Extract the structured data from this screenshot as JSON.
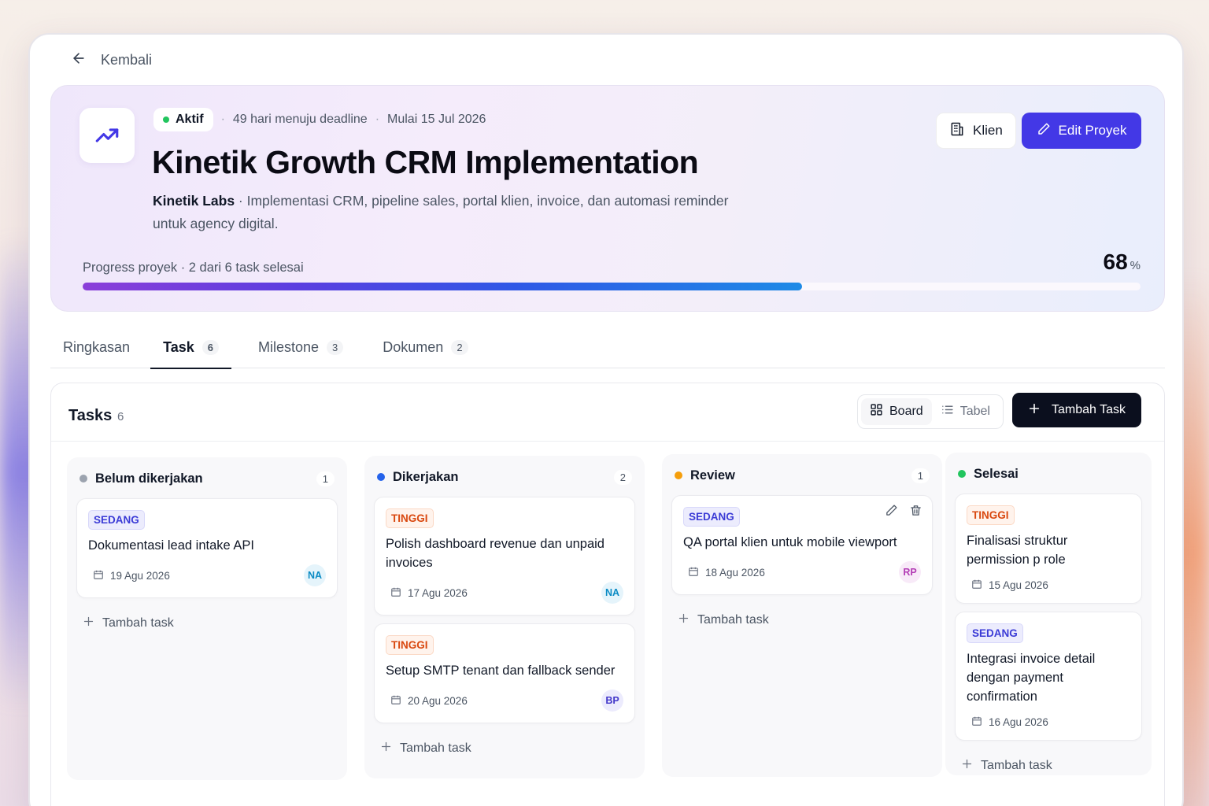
{
  "nav": {
    "back_label": "Kembali"
  },
  "project": {
    "status": "Aktif",
    "status_color": "#22c55e",
    "deadline_text": "49 hari menuju deadline",
    "start_text": "Mulai 15 Jul 2026",
    "title": "Kinetik Growth CRM Implementation",
    "client": "Kinetik Labs",
    "description": " · Implementasi CRM, pipeline sales, portal klien, invoice, dan automasi reminder untuk agency digital.",
    "client_button": "Klien",
    "edit_button": "Edit Proyek",
    "progress_label": "Progress proyek · 2 dari 6 task selesai",
    "progress_value": "68",
    "progress_unit": "%",
    "progress_fraction": 0.68
  },
  "tabs": [
    {
      "label": "Ringkasan",
      "count": ""
    },
    {
      "label": "Task",
      "count": "6"
    },
    {
      "label": "Milestone",
      "count": "3"
    },
    {
      "label": "Dokumen",
      "count": "2"
    }
  ],
  "tasks": {
    "title": "Tasks",
    "count": "6",
    "view_board": "Board",
    "view_table": "Tabel",
    "add_button": "Tambah Task",
    "add_inline": "Tambah task",
    "columns": [
      {
        "title": "Belum dikerjakan",
        "count": "1",
        "color": "#9ca3af",
        "cards": [
          {
            "priority": "SEDANG",
            "title": "Dokumentasi lead intake API",
            "date": "19 Agu 2026",
            "assignee": "NA"
          }
        ]
      },
      {
        "title": "Dikerjakan",
        "count": "2",
        "color": "#2563eb",
        "cards": [
          {
            "priority": "TINGGI",
            "title": "Polish dashboard revenue dan unpaid invoices",
            "date": "17 Agu 2026",
            "assignee": "NA"
          },
          {
            "priority": "TINGGI",
            "title": "Setup SMTP tenant dan fallback sender",
            "date": "20 Agu 2026",
            "assignee": "BP"
          }
        ]
      },
      {
        "title": "Review",
        "count": "1",
        "color": "#f59e0b",
        "cards": [
          {
            "priority": "SEDANG",
            "title": "QA portal klien untuk mobile viewport",
            "date": "18 Agu 2026",
            "assignee": "RP"
          }
        ]
      },
      {
        "title": "Selesai",
        "count": "",
        "color": "#22c55e",
        "cards": [
          {
            "priority": "TINGGI",
            "title": "Finalisasi struktur permission p role",
            "date": "15 Agu 2026",
            "assignee": ""
          },
          {
            "priority": "SEDANG",
            "title": "Integrasi invoice detail dengan payment confirmation",
            "date": "16 Agu 2026",
            "assignee": ""
          }
        ]
      }
    ]
  }
}
